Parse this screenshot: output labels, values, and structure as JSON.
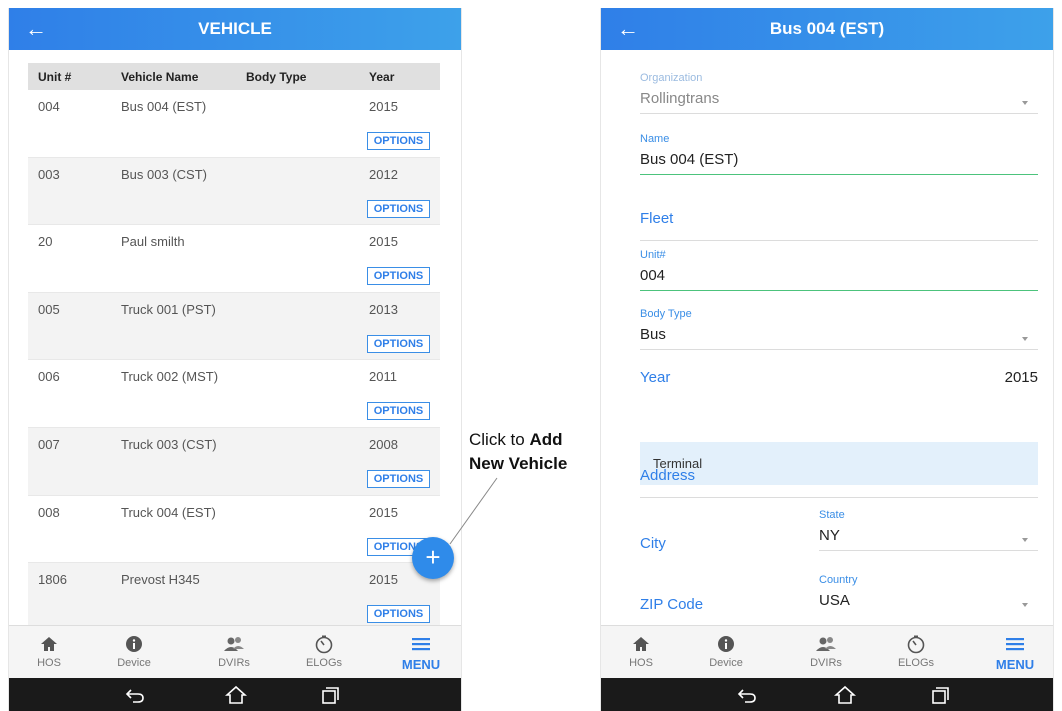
{
  "left": {
    "title": "VEHICLE",
    "table": {
      "headers": [
        "Unit #",
        "Vehicle Name",
        "Body Type",
        "Year"
      ],
      "options_label": "OPTIONS",
      "rows": [
        {
          "unit": "004",
          "name": "Bus 004 (EST)",
          "body": "",
          "year": "2015"
        },
        {
          "unit": "003",
          "name": "Bus 003 (CST)",
          "body": "",
          "year": "2012"
        },
        {
          "unit": "20",
          "name": "Paul smilth",
          "body": "",
          "year": "2015"
        },
        {
          "unit": "005",
          "name": "Truck 001 (PST)",
          "body": "",
          "year": "2013"
        },
        {
          "unit": "006",
          "name": "Truck 002 (MST)",
          "body": "",
          "year": "2011"
        },
        {
          "unit": "007",
          "name": "Truck 003 (CST)",
          "body": "",
          "year": "2008"
        },
        {
          "unit": "008",
          "name": "Truck 004 (EST)",
          "body": "",
          "year": "2015"
        },
        {
          "unit": "1806",
          "name": "Prevost H345",
          "body": "",
          "year": "2015"
        }
      ]
    },
    "fab_symbol": "+"
  },
  "callout": {
    "line1_prefix": "Click to ",
    "line1_bold": "Add",
    "line2_bold": "New Vehicle"
  },
  "right": {
    "title": "Bus 004 (EST)",
    "organization": {
      "label": "Organization",
      "value": "Rollingtrans"
    },
    "name": {
      "label": "Name",
      "value": "Bus 004 (EST)"
    },
    "fleet": {
      "label": "Fleet"
    },
    "unit": {
      "label": "Unit#",
      "value": "004"
    },
    "body_type": {
      "label": "Body Type",
      "value": "Bus"
    },
    "year": {
      "label": "Year",
      "value": "2015"
    },
    "terminal": {
      "label": "Terminal"
    },
    "address": {
      "label": "Address"
    },
    "city": {
      "label": "City"
    },
    "state": {
      "label": "State",
      "value": "NY"
    },
    "zip": {
      "label": "ZIP Code"
    },
    "country": {
      "label": "Country",
      "value": "USA"
    }
  },
  "nav": {
    "items": [
      {
        "label": "HOS",
        "icon": "home-icon"
      },
      {
        "label": "Device",
        "icon": "info-icon"
      },
      {
        "label": "DVIRs",
        "icon": "people-icon"
      },
      {
        "label": "ELOGs",
        "icon": "timer-icon"
      },
      {
        "label": "MENU",
        "icon": "menu-icon"
      }
    ]
  },
  "colors": {
    "accent": "#2f7fe8",
    "green": "#4cc37c",
    "terminal_bg": "#e3f0fb"
  }
}
